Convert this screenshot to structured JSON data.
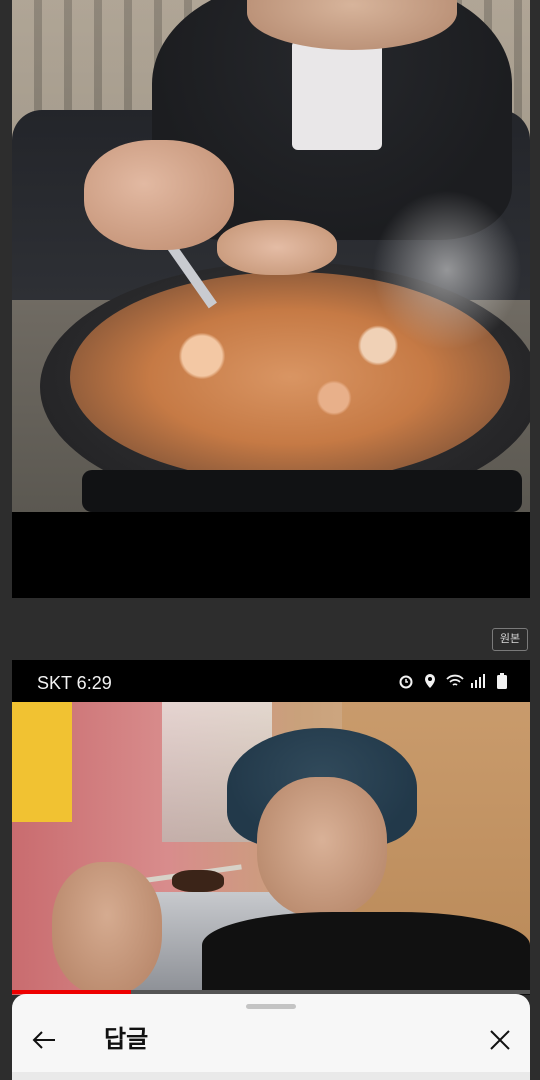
{
  "post": {
    "original_badge": "원본"
  },
  "status_bar": {
    "carrier_time": "SKT 6:29",
    "icons": [
      "alarm-icon",
      "location-icon",
      "wifi-icon",
      "signal-icon",
      "battery-icon"
    ]
  },
  "video": {
    "progress_fraction": 0.23
  },
  "sheet": {
    "title": "답글",
    "back_icon": "arrow-left-icon",
    "close_icon": "close-icon"
  },
  "colors": {
    "progress": "#ee0000",
    "sheet_bg": "#f7f7f7",
    "page_bg": "#2d2d2d"
  }
}
